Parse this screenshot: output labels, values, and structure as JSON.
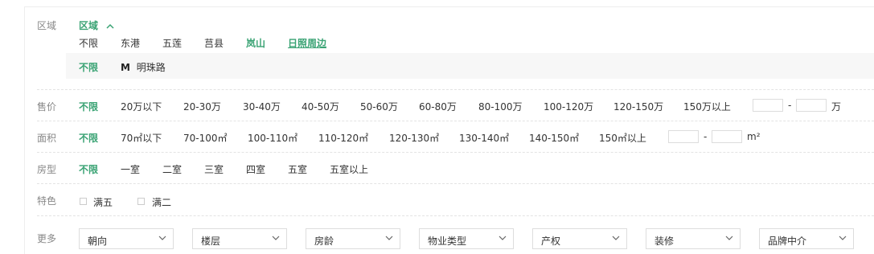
{
  "region": {
    "label": "区域",
    "toggle_label": "区域",
    "districts": [
      "不限",
      "东港",
      "五莲",
      "莒县",
      "岚山",
      "日照周边"
    ],
    "sub_unlimited": "不限",
    "metro_icon": "M",
    "metro_line": "明珠路"
  },
  "price": {
    "label": "售价",
    "options": [
      "不限",
      "20万以下",
      "20-30万",
      "30-40万",
      "40-50万",
      "50-60万",
      "60-80万",
      "80-100万",
      "100-120万",
      "120-150万",
      "150万以上"
    ],
    "range_sep": "-",
    "unit": "万"
  },
  "area": {
    "label": "面积",
    "options": [
      "不限",
      "70㎡以下",
      "70-100㎡",
      "100-110㎡",
      "110-120㎡",
      "120-130㎡",
      "130-140㎡",
      "140-150㎡",
      "150㎡以上"
    ],
    "range_sep": "-",
    "unit": "m²"
  },
  "layout": {
    "label": "房型",
    "options": [
      "不限",
      "一室",
      "二室",
      "三室",
      "四室",
      "五室",
      "五室以上"
    ]
  },
  "features": {
    "label": "特色",
    "options": [
      "满五",
      "满二"
    ]
  },
  "more": {
    "label": "更多",
    "dropdowns": [
      "朝向",
      "楼层",
      "房龄",
      "物业类型",
      "产权",
      "装修",
      "品牌中介"
    ]
  },
  "colors": {
    "accent": "#3aa374",
    "label_gray": "#888888",
    "text": "#333333"
  }
}
